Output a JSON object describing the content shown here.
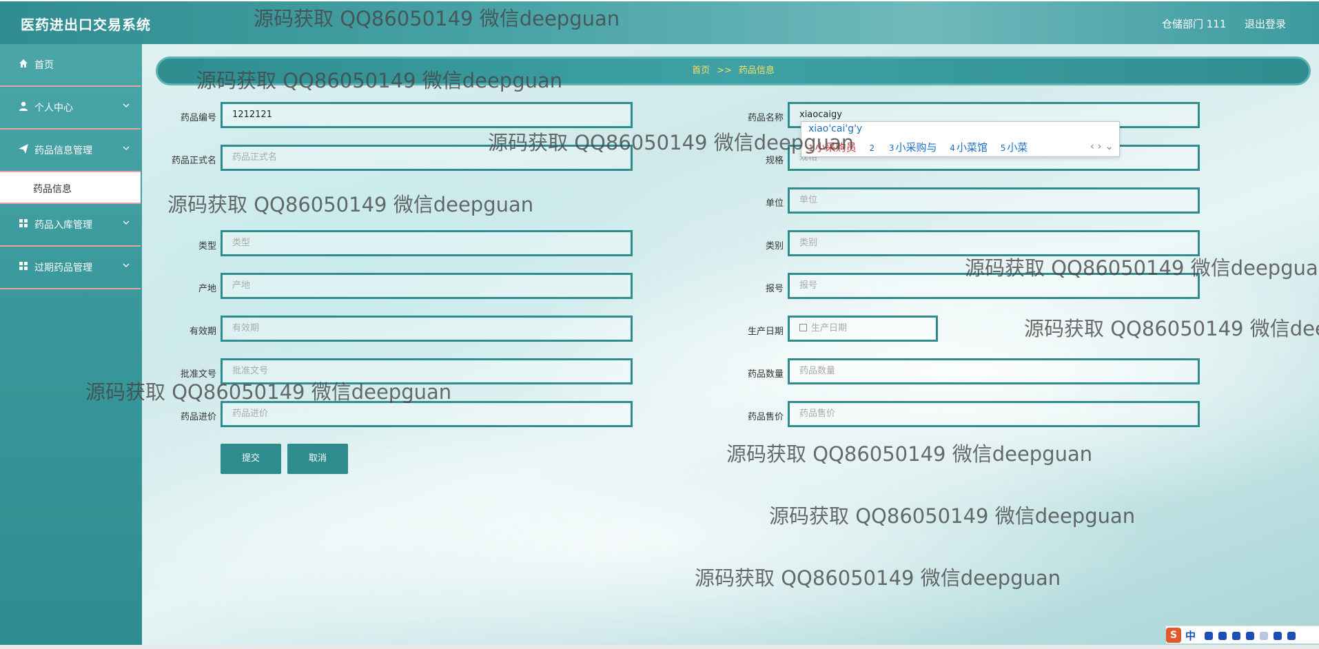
{
  "app": {
    "title": "医药进出口交易系统"
  },
  "header": {
    "user": "仓储部门 111",
    "logout": "退出登录"
  },
  "sidebar": {
    "items": [
      {
        "label": "首页",
        "icon": "home-icon"
      },
      {
        "label": "个人中心",
        "icon": "user-icon"
      },
      {
        "label": "药品信息管理",
        "icon": "send-icon"
      },
      {
        "label": "药品入库管理",
        "icon": "grid-icon"
      },
      {
        "label": "过期药品管理",
        "icon": "grid-icon"
      }
    ],
    "subitem": "药品信息"
  },
  "breadcrumb": {
    "home": "首页",
    "sep": ">>",
    "current": "药品信息"
  },
  "form": {
    "fields": [
      {
        "label": "药品编号",
        "value": "1212121",
        "placeholder": ""
      },
      {
        "label": "药品名称",
        "value": "xiaocaigy",
        "placeholder": ""
      },
      {
        "label": "药品正式名",
        "value": "",
        "placeholder": "药品正式名"
      },
      {
        "label": "规格",
        "value": "",
        "placeholder": "规格"
      },
      {
        "label": "单位",
        "value": "",
        "placeholder": "单位"
      },
      {
        "label": "类型",
        "value": "",
        "placeholder": "类型"
      },
      {
        "label": "类别",
        "value": "",
        "placeholder": "类别"
      },
      {
        "label": "产地",
        "value": "",
        "placeholder": "产地"
      },
      {
        "label": "报号",
        "value": "",
        "placeholder": "报号"
      },
      {
        "label": "有效期",
        "value": "",
        "placeholder": "有效期"
      },
      {
        "label": "生产日期",
        "value": "",
        "placeholder": "生产日期"
      },
      {
        "label": "批准文号",
        "value": "",
        "placeholder": "批准文号"
      },
      {
        "label": "药品数量",
        "value": "",
        "placeholder": "药品数量"
      },
      {
        "label": "药品进价",
        "value": "",
        "placeholder": "药品进价"
      },
      {
        "label": "药品售价",
        "value": "",
        "placeholder": "药品售价"
      }
    ],
    "submit": "提交",
    "cancel": "取消"
  },
  "ime": {
    "composition": "xiao'cai'g'y",
    "candidates": [
      {
        "n": "1",
        "text": "小采购员"
      },
      {
        "n": "2",
        "text": ""
      },
      {
        "n": "3",
        "text": "小采购与"
      },
      {
        "n": "4",
        "text": "小菜馆"
      },
      {
        "n": "5",
        "text": "小菜"
      }
    ],
    "tray": {
      "brand": "S",
      "mode": "中"
    }
  },
  "watermark": "源码获取 QQ86050149 微信deepguan",
  "colors": {
    "accent": "#2e8b8e",
    "breadcrumb_text": "#f6e06a",
    "divider": "#e9a3a3"
  }
}
